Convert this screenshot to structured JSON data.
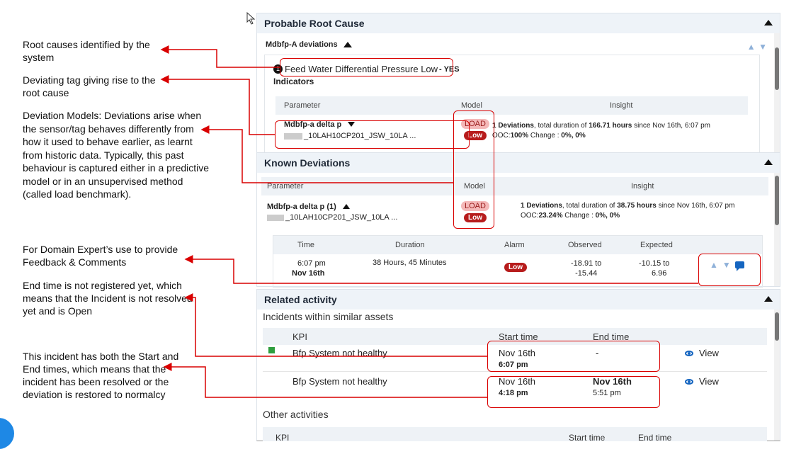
{
  "annotations": {
    "root_causes": "Root causes identified by the system",
    "deviating_tag": "Deviating tag giving rise to the root cause",
    "deviation_models_bold": "Deviation Models:",
    "deviation_models_text": "Deviations arise when the sensor/tag behaves differently from how it used to behave earlier, as learnt from historic data. Typically, this past behaviour is captured either in a predictive model or in an unsupervised method (called load benchmark).",
    "feedback": "For Domain Expert’s use to provide Feedback & Comments",
    "end_time_open": "End time is not registered yet, which means that the Incident is not resolved yet and is Open",
    "resolved": "This incident has both the Start and End times, which means that the incident has been resolved or the deviation is restored to normalcy"
  },
  "root_cause": {
    "title": "Probable Root Cause",
    "subheader": "Mdbfp-A deviations",
    "cause_number": "1",
    "cause_text": "Feed Water Differential Pressure Low",
    "cause_suffix": "- YES",
    "indicators_label": "Indicators",
    "table": {
      "col_parameter": "Parameter",
      "col_model": "Model",
      "col_insight": "Insight",
      "row": {
        "param_name": "Mdbfp-a delta p",
        "param_tag": "_10LAH10CP201_JSW_10LA ...",
        "model_load": "LOAD",
        "model_low": "Low",
        "insight_line1_a": "1 Deviations",
        "insight_line1_b": ", total duration of ",
        "insight_line1_c": "166.71 hours",
        "insight_line1_d": " since Nov 16th, 6:07 pm",
        "insight_line2_a": "OOC:",
        "insight_line2_b": "100%",
        "insight_line2_c": " Change : ",
        "insight_line2_d": "0%, 0%"
      }
    }
  },
  "known_deviations": {
    "title": "Known Deviations",
    "col_parameter": "Parameter",
    "col_model": "Model",
    "col_insight": "Insight",
    "row": {
      "param_name": "Mdbfp-a delta p (1)",
      "param_tag": "_10LAH10CP201_JSW_10LA ...",
      "model_load": "LOAD",
      "model_low": "Low",
      "insight_line1_a": "1 Deviations",
      "insight_line1_b": ", total duration of ",
      "insight_line1_c": "38.75 hours",
      "insight_line1_d": " since Nov 16th, 6:07 pm",
      "insight_line2_a": "OOC:",
      "insight_line2_b": "23.24%",
      "insight_line2_c": " Change : ",
      "insight_line2_d": "0%, 0%"
    },
    "detail": {
      "col_time": "Time",
      "col_duration": "Duration",
      "col_alarm": "Alarm",
      "col_observed": "Observed",
      "col_expected": "Expected",
      "time_line1": "6:07 pm",
      "time_line2": "Nov 16th",
      "duration": "38 Hours, 45 Minutes",
      "alarm": "Low",
      "observed_line1": "-18.91 to",
      "observed_line2": "-15.44",
      "expected_line1": "-10.15 to",
      "expected_line2": "6.96"
    }
  },
  "related_activity": {
    "title": "Related activity",
    "section1": "Incidents within similar assets",
    "col_kpi": "KPI",
    "col_start": "Start time",
    "col_end": "End time",
    "rows": [
      {
        "kpi": "Bfp System not healthy",
        "start_date": "Nov 16th",
        "start_time": "6:07 pm",
        "end_date": "-",
        "end_time": "",
        "view": "View",
        "status_color": "#2e9e3e"
      },
      {
        "kpi": "Bfp System not healthy",
        "start_date": "Nov 16th",
        "start_time": "4:18 pm",
        "end_date": "Nov 16th",
        "end_time": "5:51 pm",
        "view": "View"
      }
    ],
    "section2": "Other activities",
    "col_kpi2": "KPI",
    "col_start2": "Start time",
    "col_end2": "End time"
  },
  "colors": {
    "annotation_red": "#d90000",
    "header_bg": "#eef3f8",
    "accent_blue": "#1565c0"
  }
}
